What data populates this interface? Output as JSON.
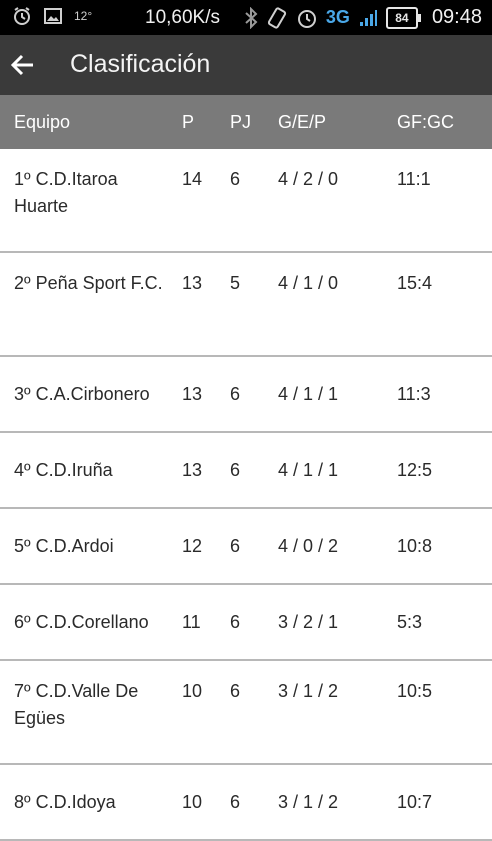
{
  "status_bar": {
    "icons": [
      "alarm-icon",
      "image-icon"
    ],
    "temperature": "12°",
    "speed": "10,60K/s",
    "network": "3G",
    "battery": "84",
    "time": "09:48"
  },
  "app_bar": {
    "back_icon": "arrow-left-icon",
    "title": "Clasificación"
  },
  "table": {
    "headers": [
      "Equipo",
      "P",
      "PJ",
      "G/E/P",
      "GF:GC"
    ],
    "rows": [
      {
        "team": "1º C.D.Itaroa Huarte",
        "p": "14",
        "pj": "6",
        "gep": "4 / 2 / 0",
        "gfgc": "11:1"
      },
      {
        "team": "2º Peña Sport F.C.",
        "p": "13",
        "pj": "5",
        "gep": "4 / 1 / 0",
        "gfgc": "15:4"
      },
      {
        "team": "3º C.A.Cirbonero",
        "p": "13",
        "pj": "6",
        "gep": "4 / 1 / 1",
        "gfgc": "11:3"
      },
      {
        "team": "4º C.D.Iruña",
        "p": "13",
        "pj": "6",
        "gep": "4 / 1 / 1",
        "gfgc": "12:5"
      },
      {
        "team": "5º C.D.Ardoi",
        "p": "12",
        "pj": "6",
        "gep": "4 / 0 / 2",
        "gfgc": "10:8"
      },
      {
        "team": "6º C.D.Corellano",
        "p": "11",
        "pj": "6",
        "gep": "3 / 2 / 1",
        "gfgc": "5:3"
      },
      {
        "team": "7º C.D.Valle De Egües",
        "p": "10",
        "pj": "6",
        "gep": "3 / 1 / 2",
        "gfgc": "10:5"
      },
      {
        "team": "8º C.D.Idoya",
        "p": "10",
        "pj": "6",
        "gep": "3 / 1 / 2",
        "gfgc": "10:7"
      }
    ]
  },
  "colors": {
    "status_bar_bg": "#000000",
    "app_bar_bg": "#3a3a3a",
    "header_bg": "#7a7a7a",
    "divider": "#b8b8b8",
    "network_accent": "#4aa8e8"
  }
}
